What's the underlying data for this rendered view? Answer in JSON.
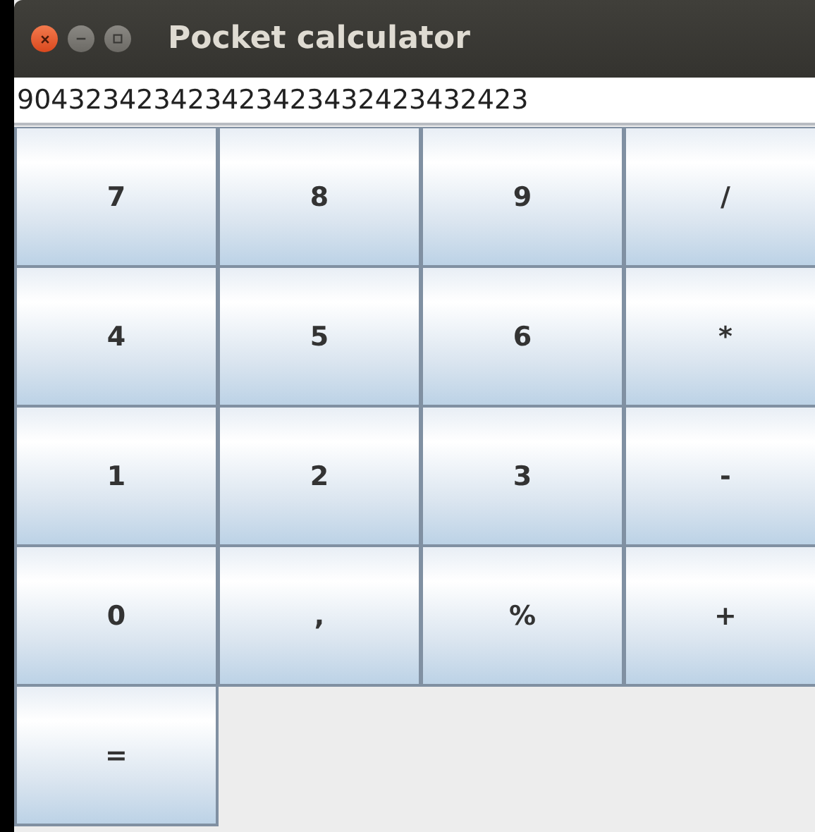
{
  "window": {
    "title": "Pocket calculator"
  },
  "display": {
    "value": "904323423423423423432423432423"
  },
  "keys": [
    "7",
    "8",
    "9",
    "/",
    "4",
    "5",
    "6",
    "*",
    "1",
    "2",
    "3",
    "-",
    "0",
    ",",
    "%",
    "+",
    "="
  ]
}
